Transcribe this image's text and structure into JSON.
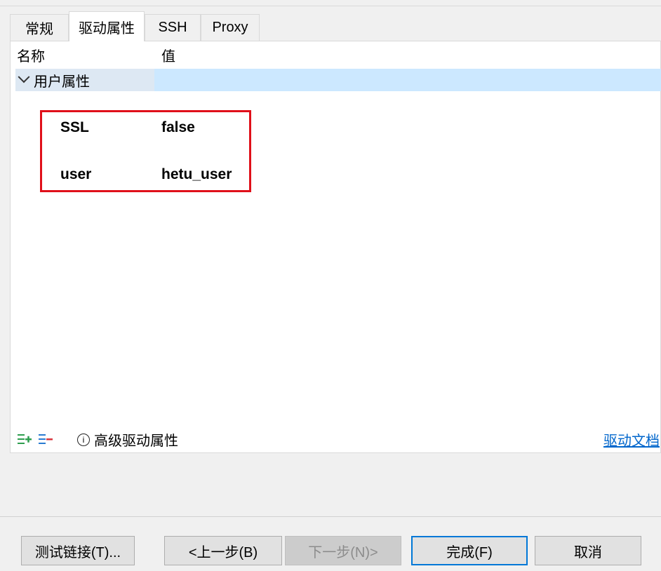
{
  "tabs": [
    {
      "label": "常规",
      "active": false
    },
    {
      "label": "驱动属性",
      "active": true
    },
    {
      "label": "SSH",
      "active": false
    },
    {
      "label": "Proxy",
      "active": false
    }
  ],
  "table": {
    "headers": {
      "name": "名称",
      "value": "值"
    },
    "group": {
      "label": "用户属性",
      "expanded": true
    },
    "properties": [
      {
        "name": "SSL",
        "value": "false"
      },
      {
        "name": "user",
        "value": "hetu_user"
      }
    ]
  },
  "toolbar": {
    "add_icon": "add-property-icon",
    "remove_icon": "remove-property-icon",
    "info_icon": "info-icon",
    "advanced_label": "高级驱动属性",
    "doc_link": "驱动文档"
  },
  "buttons": {
    "test": "测试链接(T)...",
    "back": "<上一步(B)",
    "next": "下一步(N)>",
    "finish": "完成(F)",
    "cancel": "取消"
  },
  "colors": {
    "highlight": "#e0101a",
    "selection": "#cce8ff",
    "link": "#0066cc",
    "add_icon": "#2e9e4f",
    "remove_icon": "#2a7bd1"
  }
}
